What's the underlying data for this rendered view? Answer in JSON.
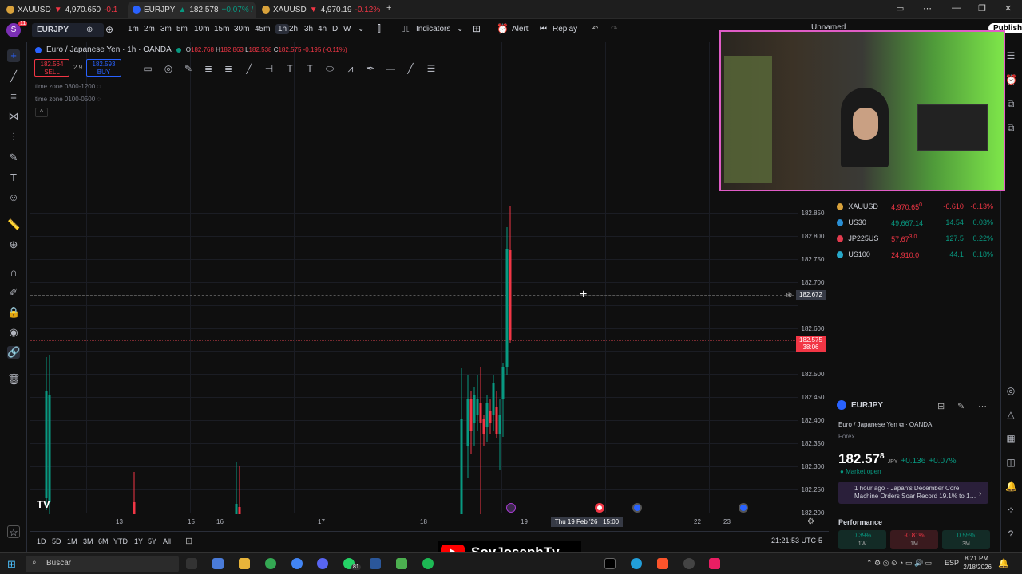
{
  "browser": {
    "tabs": [
      {
        "label": "XAUUSD",
        "price": "4,970.650",
        "change": "-0.1",
        "dir": "down"
      },
      {
        "label": "EURJPY",
        "price": "182.578",
        "change": "+0.07% /",
        "dir": "up"
      },
      {
        "label": "XAUUSD",
        "price": "4,970.19",
        "change": "-0.12%",
        "dir": "down"
      }
    ]
  },
  "toolbar": {
    "symbol": "EURJPY",
    "notif_count": "11",
    "intervals": [
      "1m",
      "2m",
      "3m",
      "5m",
      "10m",
      "15m",
      "30m",
      "45m",
      "1h",
      "2h",
      "3h",
      "4h",
      "D",
      "W"
    ],
    "selected_interval": "1h",
    "indicators_label": "Indicators",
    "alert_label": "Alert",
    "replay_label": "Replay",
    "layout_name": "Unnamed",
    "publish_label": "Publish"
  },
  "legend": {
    "title": "Euro / Japanese Yen · 1h · OANDA",
    "o_label": "O",
    "o": "182.768",
    "h_label": "H",
    "h": "182.863",
    "l_label": "L",
    "l": "182.538",
    "c_label": "C",
    "c": "182.575",
    "change": "-0.195 (-0.11%)",
    "sell_price": "182.564",
    "sell_label": "SELL",
    "spread": "2.9",
    "buy_price": "182.593",
    "buy_label": "BUY",
    "tz1": "time zone 0800-1200",
    "tz2": "time zone 0100-0500"
  },
  "price_axis": [
    "182.850",
    "182.800",
    "182.750",
    "182.700",
    "182.650",
    "182.600",
    "182.550",
    "182.500",
    "182.450",
    "182.400",
    "182.350",
    "182.300",
    "182.250",
    "182.200"
  ],
  "crosshair_price": "182.672",
  "current_price": "182.575",
  "current_countdown": "38:06",
  "date_axis": [
    "13",
    "15",
    "16",
    "17",
    "18",
    "19",
    "20",
    "22",
    "23"
  ],
  "crosshair_date": "Thu 19 Feb '26",
  "crosshair_time": "15:00",
  "timeframes": [
    "1D",
    "5D",
    "1M",
    "3M",
    "6M",
    "YTD",
    "1Y",
    "5Y",
    "All"
  ],
  "clock": "21:21:53 UTC-5",
  "watchlist": [
    {
      "symbol": "XAUUSD",
      "last": "4,970.65",
      "sup": "0",
      "chg": "-6.610",
      "pct": "-0.13%",
      "dir": "down",
      "color": "#d9a23b"
    },
    {
      "symbol": "US30",
      "last": "49,667.14",
      "sup": "",
      "chg": "14.54",
      "pct": "0.03%",
      "dir": "up",
      "color": "#2a8fd4"
    },
    {
      "symbol": "JP225US",
      "last": "57,67",
      "sup": "3.0",
      "chg": "127.5",
      "pct": "0.22%",
      "dir": "up",
      "color": "#e23b4e"
    },
    {
      "symbol": "US100",
      "last": "24,910.0",
      "sup": "",
      "chg": "44.1",
      "pct": "0.18%",
      "dir": "up",
      "color": "#27a8c9"
    }
  ],
  "details": {
    "symbol": "EURJPY",
    "description": "Euro / Japanese Yen",
    "exchange": "OANDA",
    "category": "Forex",
    "price": "182.57",
    "price_sup": "8",
    "currency": "JPY",
    "change": "+0.136",
    "change_pct": "+0.07%",
    "status": "Market open",
    "news": "1 hour ago · Japan's December Core Machine Orders Soar Record 19.1% to 1…",
    "performance_label": "Performance",
    "performance": [
      {
        "value": "0.39%",
        "period": "1W",
        "dir": "up"
      },
      {
        "value": "-0.81%",
        "period": "1M",
        "dir": "down"
      },
      {
        "value": "0.55%",
        "period": "3M",
        "dir": "up"
      }
    ]
  },
  "overlay": {
    "channel": "SoyJosephTv"
  },
  "taskbar": {
    "search_placeholder": "Buscar",
    "whatsapp_badge": "81",
    "lang": "ESP",
    "time": "8:21 PM",
    "date": "2/18/2026"
  }
}
